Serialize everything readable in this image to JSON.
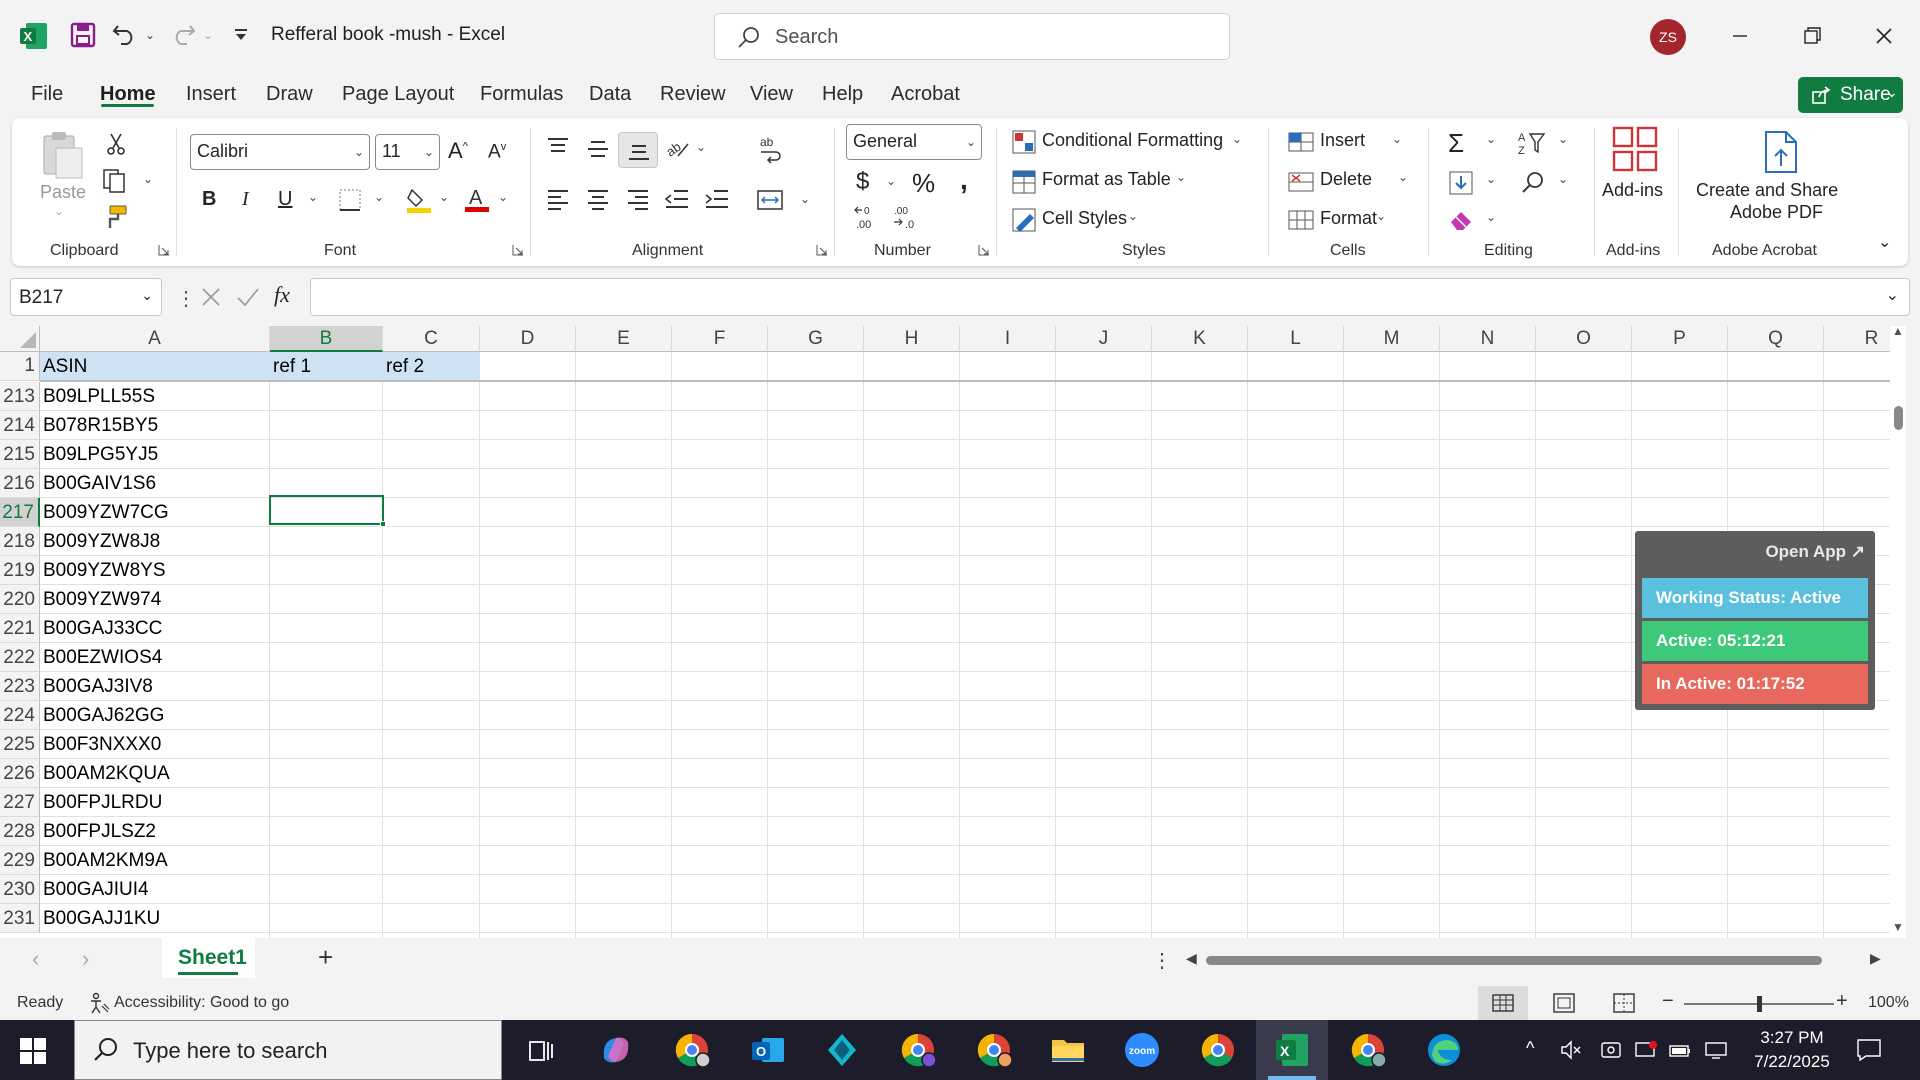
{
  "titlebar": {
    "doc_title": "Refferal book -mush  -  Excel",
    "search_placeholder": "Search",
    "avatar_initials": "ZS"
  },
  "menu": {
    "tabs": [
      "File",
      "Home",
      "Insert",
      "Draw",
      "Page Layout",
      "Formulas",
      "Data",
      "Review",
      "View",
      "Help",
      "Acrobat"
    ],
    "active_tab": "Home",
    "share_label": "Share"
  },
  "ribbon": {
    "clipboard": {
      "paste_label": "Paste",
      "group_label": "Clipboard"
    },
    "font": {
      "font_name": "Calibri",
      "font_size": "11",
      "group_label": "Font"
    },
    "alignment": {
      "group_label": "Alignment"
    },
    "number": {
      "format": "General",
      "group_label": "Number"
    },
    "styles": {
      "conditional_formatting": "Conditional Formatting",
      "format_as_table": "Format as Table",
      "cell_styles": "Cell Styles",
      "group_label": "Styles"
    },
    "cells": {
      "insert": "Insert",
      "delete": "Delete",
      "format": "Format",
      "group_label": "Cells"
    },
    "editing": {
      "group_label": "Editing"
    },
    "addins": {
      "label": "Add-ins",
      "group_label": "Add-ins"
    },
    "acrobat": {
      "label_line1": "Create and Share",
      "label_line2": "Adobe PDF",
      "group_label": "Adobe Acrobat"
    }
  },
  "formula_bar": {
    "name_box": "B217",
    "formula": ""
  },
  "grid": {
    "columns": [
      "A",
      "B",
      "C",
      "D",
      "E",
      "F",
      "G",
      "H",
      "I",
      "J",
      "K",
      "L",
      "M",
      "N",
      "O",
      "P",
      "Q",
      "R"
    ],
    "selected_column": "B",
    "header_row": {
      "row_number": "1",
      "A": "ASIN",
      "B": "ref 1",
      "C": "ref 2"
    },
    "rows": [
      {
        "num": "213",
        "asin": "B09LPLL55S"
      },
      {
        "num": "214",
        "asin": "B078R15BY5"
      },
      {
        "num": "215",
        "asin": "B09LPG5YJ5"
      },
      {
        "num": "216",
        "asin": "B00GAIV1S6"
      },
      {
        "num": "217",
        "asin": "B009YZW7CG"
      },
      {
        "num": "218",
        "asin": "B009YZW8J8"
      },
      {
        "num": "219",
        "asin": "B009YZW8YS"
      },
      {
        "num": "220",
        "asin": "B009YZW974"
      },
      {
        "num": "221",
        "asin": "B00GAJ33CC"
      },
      {
        "num": "222",
        "asin": "B00EZWIOS4"
      },
      {
        "num": "223",
        "asin": "B00GAJ3IV8"
      },
      {
        "num": "224",
        "asin": "B00GAJ62GG"
      },
      {
        "num": "225",
        "asin": "B00F3NXXX0"
      },
      {
        "num": "226",
        "asin": "B00AM2KQUA"
      },
      {
        "num": "227",
        "asin": "B00FPJLRDU"
      },
      {
        "num": "228",
        "asin": "B00FPJLSZ2"
      },
      {
        "num": "229",
        "asin": "B00AM2KM9A"
      },
      {
        "num": "230",
        "asin": "B00GAJIUI4"
      },
      {
        "num": "231",
        "asin": "B00GAJJ1KU"
      }
    ],
    "selected_row": "217",
    "selected_cell": "B217"
  },
  "widget": {
    "open_app": "Open App ↗",
    "working_status": "Working Status: Active",
    "active": "Active: 05:12:21",
    "inactive": "In Active: 01:17:52",
    "colors": {
      "status": "#5bc0de",
      "active": "#3ec97a",
      "inactive": "#e8685e"
    }
  },
  "sheets": {
    "tabs": [
      "Sheet1"
    ],
    "add_label": "+"
  },
  "statusbar": {
    "ready": "Ready",
    "accessibility": "Accessibility: Good to go",
    "zoom": "100%",
    "zoom_level": 0.5
  },
  "taskbar": {
    "search_placeholder": "Type here to search",
    "time": "3:27 PM",
    "date": "7/22/2025",
    "apps": [
      "task-view-icon",
      "copilot-icon",
      "chrome-icon",
      "outlook-icon",
      "app-icon",
      "chrome-profile-icon",
      "chrome-profile-icon",
      "file-explorer-icon",
      "zoom-icon",
      "chrome-icon",
      "excel-icon",
      "chrome-profile-icon",
      "edge-icon"
    ]
  },
  "colors": {
    "excel_green": "#107c41",
    "selection_blue": "#cfe2f3"
  }
}
